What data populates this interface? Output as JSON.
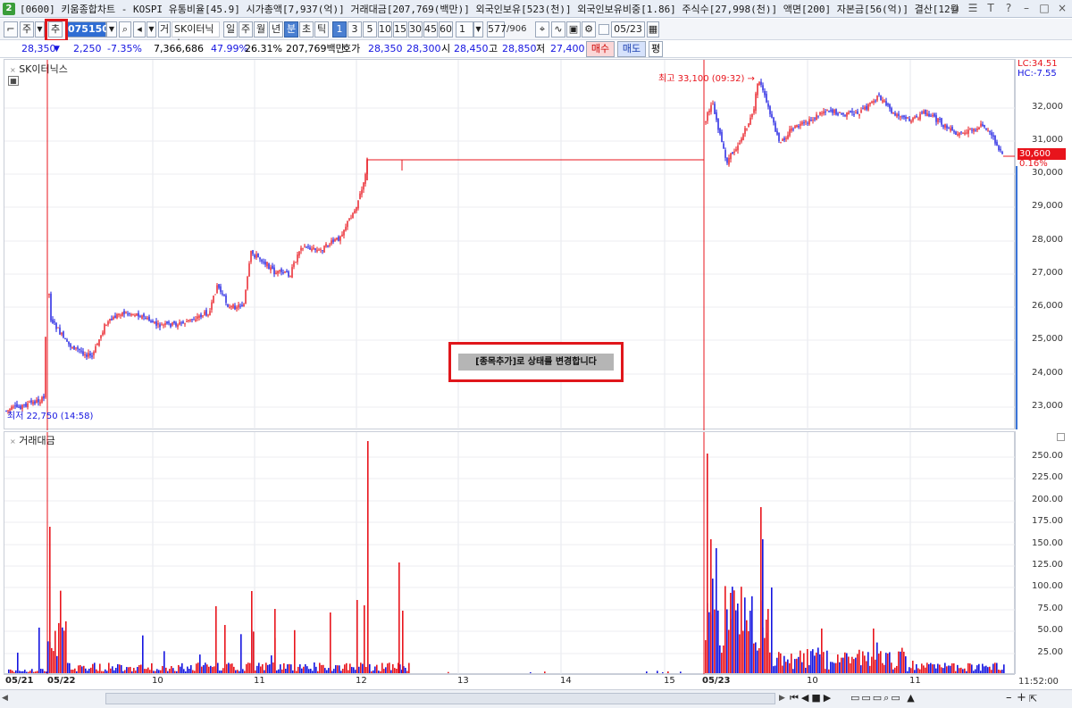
{
  "window": {
    "number": "2",
    "title": "[0600] 키움종합차트 - KOSPI 유통비율[45.9] 시가총액[7,937(억)] 거래대금[207,769(백만)] 외국인보유[523(천)] 외국인보유비중[1.86] 주식수[27,998(천)] 액면[200] 자본금[56(억)] 결산[12월]"
  },
  "toolbar": {
    "type_label": "주",
    "add_label": "추",
    "code": "075150",
    "stock_button": "거",
    "stock_name": "SK이터닉스",
    "period_day": "일",
    "period_week": "주",
    "period_month": "월",
    "period_year": "년",
    "period_min": "분",
    "period_sec": "초",
    "period_tick": "틱",
    "intervals": [
      "1",
      "3",
      "5",
      "10",
      "15",
      "30",
      "45",
      "60"
    ],
    "interval_value": "1",
    "count": "577",
    "count_total": "/906",
    "date": "05/23"
  },
  "quote": {
    "price": "28,350",
    "change": "2,250",
    "change_pct": "-7.35%",
    "volume": "7,366,686",
    "pct1": "47.99%",
    "pct2": "26.31%",
    "amount": "207,769백만",
    "hoga_label": "호가",
    "hoga1": "28,350",
    "hoga2": "28,300",
    "open_label": "시",
    "open": "28,450",
    "high_label": "고",
    "high": "28,850",
    "low_label": "저",
    "low": "27,400",
    "buy": "매수",
    "sell": "매도",
    "avg": "평"
  },
  "price_panel": {
    "name": "SK이터닉스",
    "lc": "LC:34.51",
    "hc": "HC:-7.55",
    "high_note": "최고 33,100 (09:32) →",
    "low_note": "최저 22,750 (14:58)",
    "last_price": "30,600",
    "last_pct": "0.16%",
    "y_ticks": [
      "32,000",
      "31,000",
      "30,000",
      "29,000",
      "28,000",
      "27,000",
      "26,000",
      "25,000",
      "24,000",
      "23,000"
    ]
  },
  "volume_panel": {
    "name": "거래대금",
    "y_ticks": [
      "250.00",
      "225.00",
      "200.00",
      "175.00",
      "150.00",
      "125.00",
      "100.00",
      "75.00",
      "50.00",
      "25.00"
    ]
  },
  "x_axis": {
    "labels": [
      "05/21",
      "05/22",
      "10",
      "11",
      "12",
      "13",
      "14",
      "15",
      "05/23",
      "10",
      "11"
    ],
    "time": "11:52:00"
  },
  "notice": {
    "text": "[종목추가]로 상태를 변경합니다"
  },
  "colors": {
    "up": "#e8141c",
    "down": "#1414e0",
    "accent": "#2f6dd3"
  }
}
